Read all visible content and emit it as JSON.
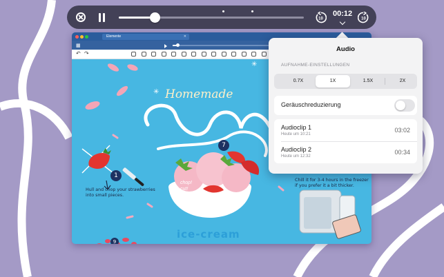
{
  "player": {
    "time": "00:12",
    "progress_fraction": 0.19,
    "icons": [
      "close-circle-icon",
      "pause-icon",
      "rewind-10-icon",
      "forward-10-icon",
      "chevron-down-icon"
    ]
  },
  "popover": {
    "title": "Audio",
    "section_header": "AUFNAHME-EINSTELLUNGEN",
    "speed_options": [
      "0.7X",
      "1X",
      "1.5X",
      "2X"
    ],
    "selected_speed": "1X",
    "noise_label": "Geräuschreduzierung",
    "noise_on": false,
    "clips": [
      {
        "title": "Audioclip 1",
        "date": "Heute um 10:21",
        "duration": "03:02"
      },
      {
        "title": "Audioclip 2",
        "date": "Heute um 12:32",
        "duration": "00:34"
      }
    ]
  },
  "window": {
    "tab_title": "Elemente",
    "canvas": {
      "homemade": "Homemade",
      "chop": "chop!\ncut!",
      "step_left_number": "1",
      "step_middle_number": "7",
      "hull_text": "Hull and chop your strawberries into small pieces.",
      "chill_text": "Chill it for 3-4 hours in the freezer if you prefer it a bit thicker.",
      "ice_cream": "ice-cream",
      "bottom_number": "9"
    }
  },
  "colors": {
    "background": "#a49ac6",
    "player_bg": "#434157",
    "canvas_bg": "#47b7e2",
    "popover_bg": "#f3f3f4"
  }
}
